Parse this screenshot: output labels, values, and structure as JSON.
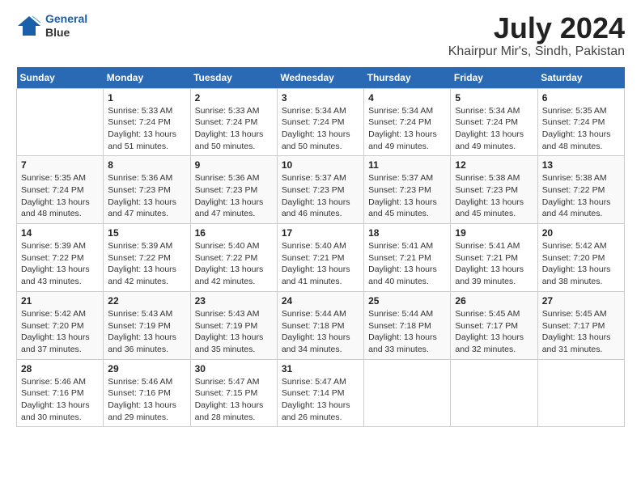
{
  "header": {
    "logo_line1": "General",
    "logo_line2": "Blue",
    "title": "July 2024",
    "subtitle": "Khairpur Mir's, Sindh, Pakistan"
  },
  "weekdays": [
    "Sunday",
    "Monday",
    "Tuesday",
    "Wednesday",
    "Thursday",
    "Friday",
    "Saturday"
  ],
  "weeks": [
    [
      {
        "day": "",
        "info": ""
      },
      {
        "day": "1",
        "info": "Sunrise: 5:33 AM\nSunset: 7:24 PM\nDaylight: 13 hours\nand 51 minutes."
      },
      {
        "day": "2",
        "info": "Sunrise: 5:33 AM\nSunset: 7:24 PM\nDaylight: 13 hours\nand 50 minutes."
      },
      {
        "day": "3",
        "info": "Sunrise: 5:34 AM\nSunset: 7:24 PM\nDaylight: 13 hours\nand 50 minutes."
      },
      {
        "day": "4",
        "info": "Sunrise: 5:34 AM\nSunset: 7:24 PM\nDaylight: 13 hours\nand 49 minutes."
      },
      {
        "day": "5",
        "info": "Sunrise: 5:34 AM\nSunset: 7:24 PM\nDaylight: 13 hours\nand 49 minutes."
      },
      {
        "day": "6",
        "info": "Sunrise: 5:35 AM\nSunset: 7:24 PM\nDaylight: 13 hours\nand 48 minutes."
      }
    ],
    [
      {
        "day": "7",
        "info": "Sunrise: 5:35 AM\nSunset: 7:24 PM\nDaylight: 13 hours\nand 48 minutes."
      },
      {
        "day": "8",
        "info": "Sunrise: 5:36 AM\nSunset: 7:23 PM\nDaylight: 13 hours\nand 47 minutes."
      },
      {
        "day": "9",
        "info": "Sunrise: 5:36 AM\nSunset: 7:23 PM\nDaylight: 13 hours\nand 47 minutes."
      },
      {
        "day": "10",
        "info": "Sunrise: 5:37 AM\nSunset: 7:23 PM\nDaylight: 13 hours\nand 46 minutes."
      },
      {
        "day": "11",
        "info": "Sunrise: 5:37 AM\nSunset: 7:23 PM\nDaylight: 13 hours\nand 45 minutes."
      },
      {
        "day": "12",
        "info": "Sunrise: 5:38 AM\nSunset: 7:23 PM\nDaylight: 13 hours\nand 45 minutes."
      },
      {
        "day": "13",
        "info": "Sunrise: 5:38 AM\nSunset: 7:22 PM\nDaylight: 13 hours\nand 44 minutes."
      }
    ],
    [
      {
        "day": "14",
        "info": "Sunrise: 5:39 AM\nSunset: 7:22 PM\nDaylight: 13 hours\nand 43 minutes."
      },
      {
        "day": "15",
        "info": "Sunrise: 5:39 AM\nSunset: 7:22 PM\nDaylight: 13 hours\nand 42 minutes."
      },
      {
        "day": "16",
        "info": "Sunrise: 5:40 AM\nSunset: 7:22 PM\nDaylight: 13 hours\nand 42 minutes."
      },
      {
        "day": "17",
        "info": "Sunrise: 5:40 AM\nSunset: 7:21 PM\nDaylight: 13 hours\nand 41 minutes."
      },
      {
        "day": "18",
        "info": "Sunrise: 5:41 AM\nSunset: 7:21 PM\nDaylight: 13 hours\nand 40 minutes."
      },
      {
        "day": "19",
        "info": "Sunrise: 5:41 AM\nSunset: 7:21 PM\nDaylight: 13 hours\nand 39 minutes."
      },
      {
        "day": "20",
        "info": "Sunrise: 5:42 AM\nSunset: 7:20 PM\nDaylight: 13 hours\nand 38 minutes."
      }
    ],
    [
      {
        "day": "21",
        "info": "Sunrise: 5:42 AM\nSunset: 7:20 PM\nDaylight: 13 hours\nand 37 minutes."
      },
      {
        "day": "22",
        "info": "Sunrise: 5:43 AM\nSunset: 7:19 PM\nDaylight: 13 hours\nand 36 minutes."
      },
      {
        "day": "23",
        "info": "Sunrise: 5:43 AM\nSunset: 7:19 PM\nDaylight: 13 hours\nand 35 minutes."
      },
      {
        "day": "24",
        "info": "Sunrise: 5:44 AM\nSunset: 7:18 PM\nDaylight: 13 hours\nand 34 minutes."
      },
      {
        "day": "25",
        "info": "Sunrise: 5:44 AM\nSunset: 7:18 PM\nDaylight: 13 hours\nand 33 minutes."
      },
      {
        "day": "26",
        "info": "Sunrise: 5:45 AM\nSunset: 7:17 PM\nDaylight: 13 hours\nand 32 minutes."
      },
      {
        "day": "27",
        "info": "Sunrise: 5:45 AM\nSunset: 7:17 PM\nDaylight: 13 hours\nand 31 minutes."
      }
    ],
    [
      {
        "day": "28",
        "info": "Sunrise: 5:46 AM\nSunset: 7:16 PM\nDaylight: 13 hours\nand 30 minutes."
      },
      {
        "day": "29",
        "info": "Sunrise: 5:46 AM\nSunset: 7:16 PM\nDaylight: 13 hours\nand 29 minutes."
      },
      {
        "day": "30",
        "info": "Sunrise: 5:47 AM\nSunset: 7:15 PM\nDaylight: 13 hours\nand 28 minutes."
      },
      {
        "day": "31",
        "info": "Sunrise: 5:47 AM\nSunset: 7:14 PM\nDaylight: 13 hours\nand 26 minutes."
      },
      {
        "day": "",
        "info": ""
      },
      {
        "day": "",
        "info": ""
      },
      {
        "day": "",
        "info": ""
      }
    ]
  ]
}
